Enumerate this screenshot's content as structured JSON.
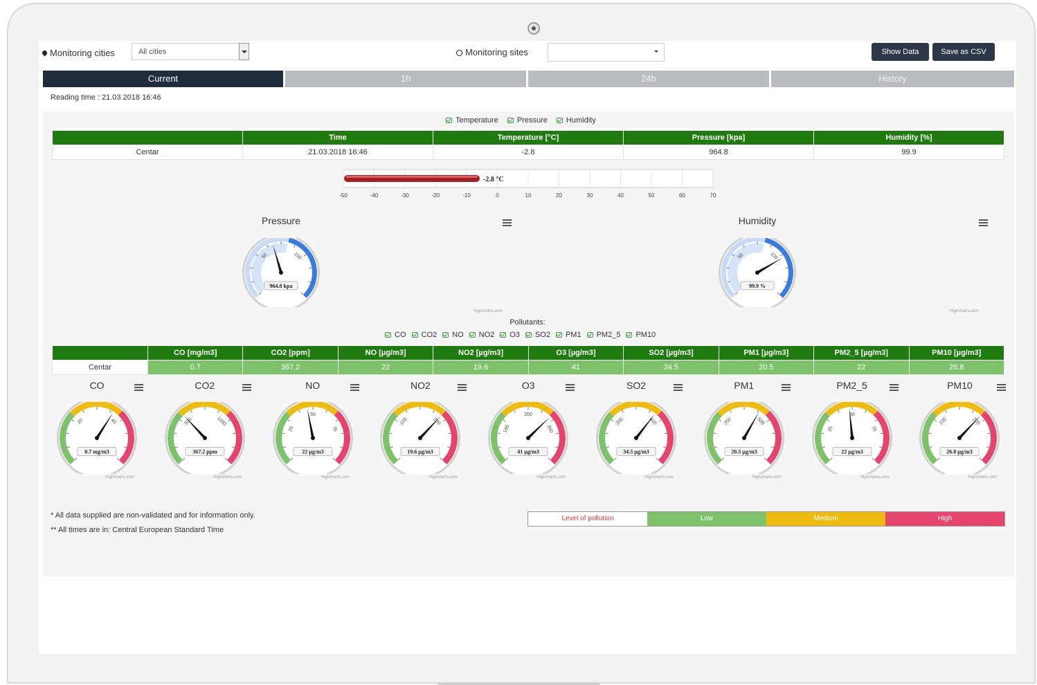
{
  "header": {
    "cities_label": "Monitoring cities",
    "cities_value": "All cities",
    "sites_label": "Monitoring sites",
    "sites_value": "",
    "show_data": "Show Data",
    "save_csv": "Save as CSV"
  },
  "tabs": [
    {
      "label": "Current",
      "active": true
    },
    {
      "label": "1h",
      "active": false
    },
    {
      "label": "24h",
      "active": false
    },
    {
      "label": "History",
      "active": false
    }
  ],
  "reading_time": "Reading time : 21.03.2018 16:46",
  "weather": {
    "legend": [
      "Temperature",
      "Pressure",
      "Humidity"
    ],
    "headers": [
      "",
      "Time",
      "Temperature [°C]",
      "Pressure [kpa]",
      "Humidity [%]"
    ],
    "row": [
      "Centar",
      "21.03.2018 16:46",
      "-2.8",
      "964.8",
      "99.9"
    ]
  },
  "thermometer": {
    "value": -2.8,
    "label": "-2.8 °C",
    "min": -50,
    "max": 70,
    "ticks": [
      "-50",
      "-40",
      "-30",
      "-20",
      "-10",
      "0",
      "10",
      "20",
      "30",
      "40",
      "50",
      "60",
      "70"
    ]
  },
  "big_gauges": [
    {
      "title": "Pressure",
      "label": "964.8 kpa",
      "fraction": 0.44,
      "ticks": [
        "50",
        "100"
      ],
      "credit": "Highcharts.com"
    },
    {
      "title": "Humidity",
      "label": "99.9 %",
      "fraction": 0.72,
      "ticks": [
        "50",
        "100"
      ],
      "credit": "Highcharts.com"
    }
  ],
  "pollutants": {
    "label": "Pollutants:",
    "legend": [
      "CO",
      "CO2",
      "NO",
      "NO2",
      "O3",
      "SO2",
      "PM1",
      "PM2_5",
      "PM10"
    ],
    "headers": [
      "",
      "CO [mg/m3]",
      "CO2 [ppm]",
      "NO [µg/m3]",
      "NO2 [µg/m3]",
      "O3 [µg/m3]",
      "SO2 [µg/m3]",
      "PM1 [µg/m3]",
      "PM2_5 [µg/m3]",
      "PM10 [µg/m3]"
    ],
    "row": [
      "Centar",
      "0.7",
      "367.2",
      "22",
      "19.6",
      "41",
      "34.5",
      "20.5",
      "22",
      "26.8"
    ]
  },
  "small_gauges": [
    {
      "title": "CO",
      "label": "0.7 mg/m3",
      "fraction": 0.62,
      "ticks": [
        "20",
        "40"
      ],
      "credit": "Highcharts.com"
    },
    {
      "title": "CO2",
      "label": "367.2 ppm",
      "fraction": 0.34,
      "ticks": [
        "500",
        "1000"
      ],
      "credit": "Highcharts.com"
    },
    {
      "title": "NO",
      "label": "22 µg/m3",
      "fraction": 0.46,
      "ticks": [
        "25",
        "50",
        "75"
      ],
      "credit": "Highcharts.com"
    },
    {
      "title": "NO2",
      "label": "19.6 µg/m3",
      "fraction": 0.66,
      "ticks": [
        "100",
        "200"
      ],
      "credit": "Highcharts.com"
    },
    {
      "title": "O3",
      "label": "41 µg/m3",
      "fraction": 0.67,
      "ticks": [
        "100",
        "200",
        "300"
      ],
      "credit": "Highcharts.com"
    },
    {
      "title": "SO2",
      "label": "34.5 µg/m3",
      "fraction": 0.64,
      "ticks": [
        "200",
        "400"
      ],
      "credit": "Highcharts.com"
    },
    {
      "title": "PM1",
      "label": "20.5 µg/m3",
      "fraction": 0.61,
      "ticks": [
        "250",
        "500"
      ],
      "credit": "Highcharts.com"
    },
    {
      "title": "PM2_5",
      "label": "22 µg/m3",
      "fraction": 0.48,
      "ticks": [
        "25",
        "50",
        "75"
      ],
      "credit": "Highcharts.com"
    },
    {
      "title": "PM10",
      "label": "26.8 µg/m3",
      "fraction": 0.66,
      "ticks": [
        "100",
        "200"
      ],
      "credit": "Highcharts.com"
    }
  ],
  "notes": [
    "* All data supplied are non-validated and for information only.",
    "** All times are in: Central European Standard Time"
  ],
  "pollution_scale": [
    "Level of pollution",
    "Low",
    "Medium",
    "High"
  ],
  "colors": {
    "header_green": "#1f7a0f",
    "value_green": "#7dc26b",
    "low": "#7dc26b",
    "medium": "#eebb10",
    "high": "#e5456c",
    "dark_button": "#2c3847",
    "gauge_blue": "#3b7be0"
  }
}
